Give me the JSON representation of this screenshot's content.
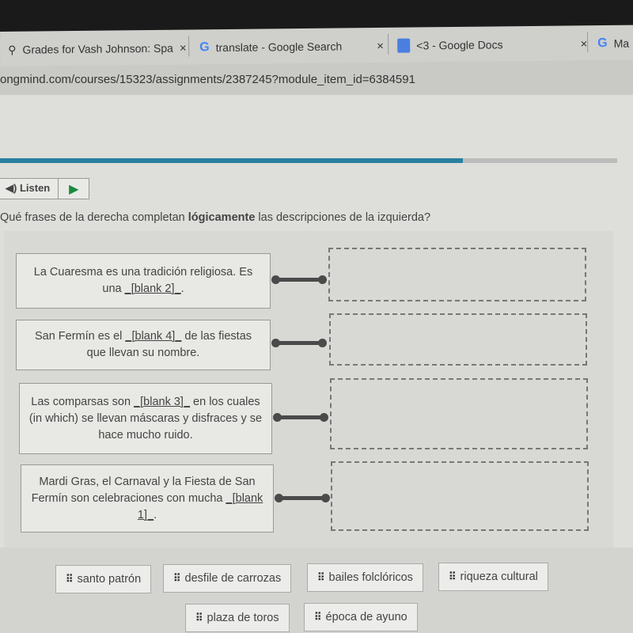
{
  "browser": {
    "tabs": [
      {
        "title": "Grades for Vash Johnson: Spa",
        "icon": "location-pin-icon"
      },
      {
        "title": "translate - Google Search",
        "icon": "google-icon"
      },
      {
        "title": "<3 - Google Docs",
        "icon": "google-docs-icon"
      },
      {
        "title": "Ma",
        "icon": "google-icon"
      }
    ],
    "close_glyph": "×",
    "url": "ongmind.com/courses/15323/assignments/2387245?module_item_id=6384591"
  },
  "assignment": {
    "progress_percent": 75,
    "listen_label": "Listen",
    "question_prefix": "Qué frases de la derecha completan ",
    "question_bold": "lógicamente",
    "question_suffix": " las descripciones de la izquierda?"
  },
  "prompts": [
    {
      "before": "La Cuaresma es una tradición religiosa. Es una ",
      "blank": "_[blank 2]_",
      "after": "."
    },
    {
      "before": "San Fermín es el ",
      "blank": "_[blank 4]_",
      "after": " de las fiestas que llevan su nombre."
    },
    {
      "before": "Las comparsas son ",
      "blank": "_[blank 3]_",
      "after": " en los cuales (in which) se llevan máscaras y disfraces y se hace mucho ruido."
    },
    {
      "before": "Mardi Gras, el Carnaval y la Fiesta de San Fermín son celebraciones con mucha ",
      "blank": "_[blank 1]_",
      "after": "."
    }
  ],
  "choices": [
    "santo patrón",
    "desfile de carrozas",
    "bailes folclóricos",
    "riqueza cultural",
    "plaza de toros",
    "época de ayuno"
  ],
  "drag_handle_glyph": "⠿"
}
